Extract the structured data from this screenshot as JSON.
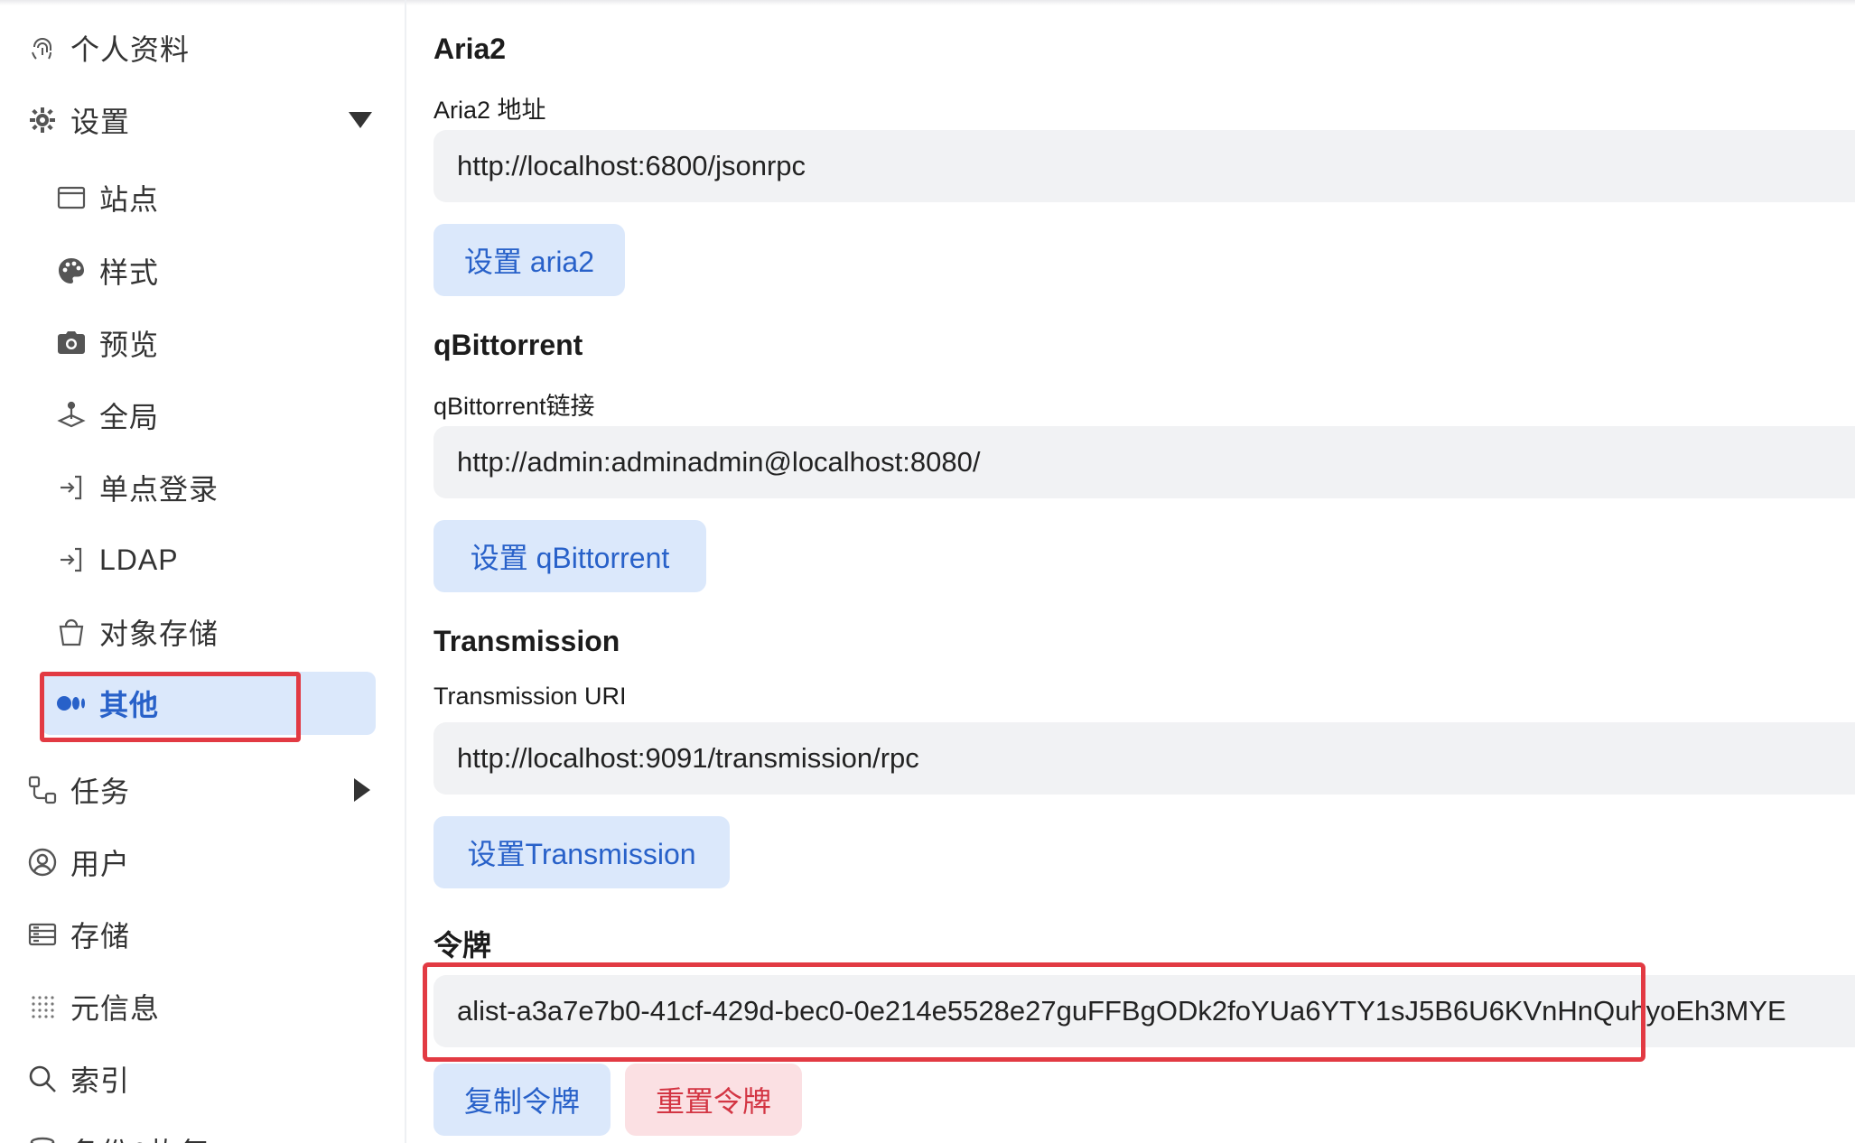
{
  "sidebar": {
    "items": [
      {
        "label": "个人资料",
        "icon": "fingerprint-icon"
      },
      {
        "label": "设置",
        "icon": "gear-icon",
        "caret": "caret-down-icon"
      },
      {
        "label": "站点",
        "icon": "window-icon"
      },
      {
        "label": "样式",
        "icon": "palette-icon"
      },
      {
        "label": "预览",
        "icon": "camera-icon"
      },
      {
        "label": "全局",
        "icon": "joystick-icon"
      },
      {
        "label": "单点登录",
        "icon": "login-arrow-icon"
      },
      {
        "label": "LDAP",
        "icon": "login-arrow-icon"
      },
      {
        "label": "对象存储",
        "icon": "bucket-icon"
      },
      {
        "label": "其他",
        "icon": "dots-icon",
        "active": true
      },
      {
        "label": "任务",
        "icon": "flow-icon",
        "caret": "caret-right-icon"
      },
      {
        "label": "用户",
        "icon": "user-circle-icon"
      },
      {
        "label": "存储",
        "icon": "storage-icon"
      },
      {
        "label": "元信息",
        "icon": "dot-grid-icon"
      },
      {
        "label": "索引",
        "icon": "search-icon"
      },
      {
        "label": "备份&恢复",
        "icon": "database-icon"
      }
    ]
  },
  "main": {
    "aria2": {
      "title": "Aria2",
      "field_label": "Aria2 地址",
      "value": "http://localhost:6800/jsonrpc",
      "button": "设置 aria2"
    },
    "qbittorrent": {
      "title": "qBittorrent",
      "field_label": "qBittorrent链接",
      "value": "http://admin:adminadmin@localhost:8080/",
      "button": "设置 qBittorrent"
    },
    "transmission": {
      "title": "Transmission",
      "field_label": "Transmission URI",
      "value": "http://localhost:9091/transmission/rpc",
      "button": "设置Transmission"
    },
    "token": {
      "title": "令牌",
      "value": "alist-a3a7e7b0-41cf-429d-bec0-0e214e5528e27guFFBgODk2foYUa6YTY1sJ5B6U6KVnHnQuhyoEh3MYE",
      "copy_button": "复制令牌",
      "reset_button": "重置令牌"
    }
  },
  "colors": {
    "accent": "#2861c9",
    "accent_bg": "#dbe8fb",
    "danger": "#d33543",
    "danger_bg": "#fbe0e3",
    "highlight_outline": "#e23a43",
    "field_bg": "#f1f2f4"
  }
}
